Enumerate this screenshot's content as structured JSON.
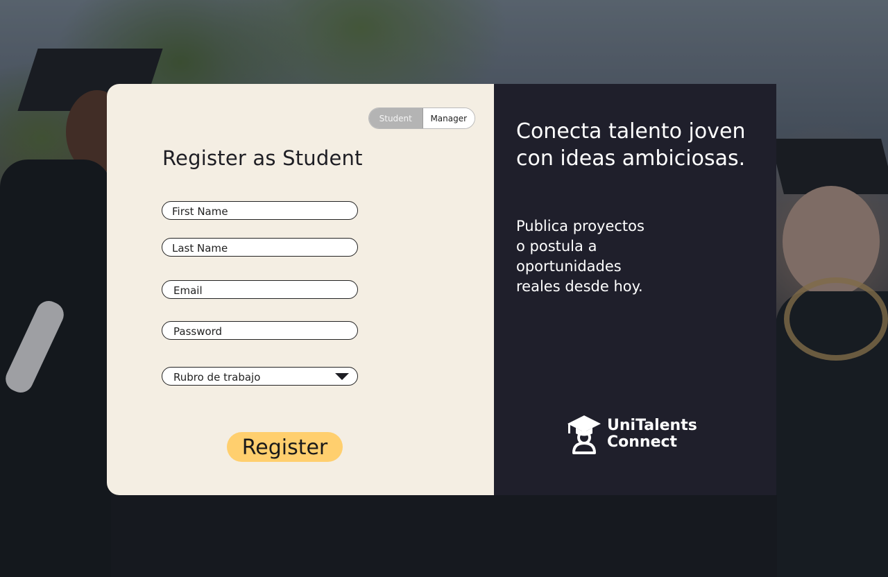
{
  "toggle": {
    "student_label": "Student",
    "manager_label": "Manager",
    "selected": "Student"
  },
  "form": {
    "title": "Register as Student",
    "first_name_placeholder": "First Name",
    "last_name_placeholder": "Last Name",
    "email_placeholder": "Email",
    "password_placeholder": "Password",
    "rubro_select_value": "Rubro de trabajo",
    "register_label": "Register"
  },
  "promo": {
    "headline": "Conecta talento joven con ideas ambiciosas.",
    "subtext_lines": [
      "Publica proyectos",
      "o postula a",
      "oportunidades",
      "reales desde hoy."
    ]
  },
  "brand": {
    "line1": "UniTalents",
    "line2": "Connect",
    "icon": "graduate-cap-person-icon"
  },
  "colors": {
    "card_left_bg": "#f4eee3",
    "card_right_bg": "#1f1f2b",
    "register_button": "#ffcf6e",
    "toggle_active": "#b4b4b4"
  }
}
